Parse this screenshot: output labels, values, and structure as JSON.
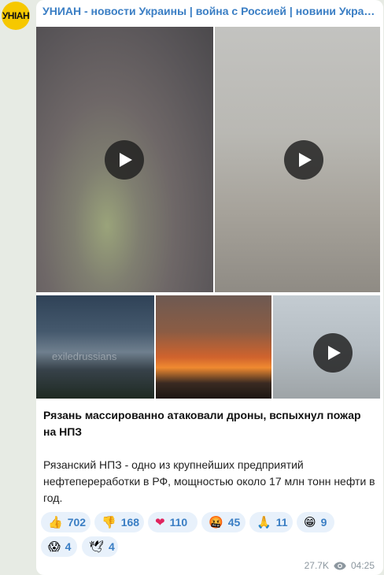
{
  "channel": {
    "avatar_text": "УНІАН",
    "title": "УНИАН - новости Украины | война с Россией | новини України..."
  },
  "post": {
    "headline": "Рязань массированно атаковали дроны, вспыхнул пожар на НПЗ",
    "body": "Рязанский НПЗ - одно из крупнейших предприятий нефтепереработки в РФ, мощностью около 17 млн тонн нефти в год.",
    "watermark": "exiledrussians"
  },
  "reactions": [
    {
      "emoji": "👍",
      "icon": "thumbs-up-icon",
      "count": "702"
    },
    {
      "emoji": "👎",
      "icon": "thumbs-down-icon",
      "count": "168"
    },
    {
      "emoji": "❤",
      "icon": "heart-icon",
      "count": "110"
    },
    {
      "emoji": "🤬",
      "icon": "angry-face-icon",
      "count": "45"
    },
    {
      "emoji": "🙏",
      "icon": "folded-hands-icon",
      "count": "11"
    },
    {
      "emoji": "😁",
      "icon": "grin-icon",
      "count": "9"
    },
    {
      "emoji": "😱",
      "icon": "scream-icon",
      "count": "4"
    },
    {
      "emoji": "🕊",
      "icon": "dove-icon",
      "count": "4"
    }
  ],
  "meta": {
    "views": "27.7K",
    "time": "04:25"
  },
  "colors": {
    "accent": "#3a7ec4",
    "avatar_bg": "#f6c800"
  }
}
